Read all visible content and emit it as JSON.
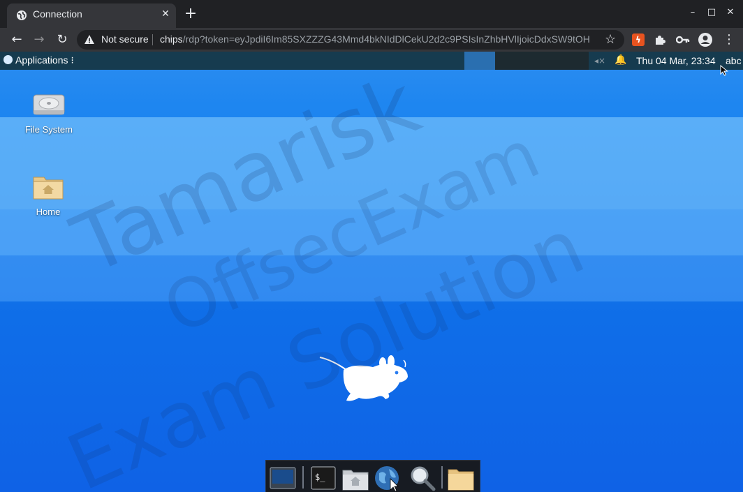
{
  "browser": {
    "tab_title": "Connection",
    "tab_close": "✕",
    "new_tab": "+",
    "window": {
      "minimize": "–",
      "maximize": "□",
      "close": "✕"
    },
    "nav": {
      "back": "←",
      "forward": "→",
      "reload": "↻"
    },
    "security_label": "Not secure",
    "url_host": "chips",
    "url_path": "/rdp?token=eyJpdiI6Im85SXZZZG43Mmd4bkNIdDlCekU2d2c9PSIsInZhbHVlIjoicDdxSW9tOH",
    "star": "☆",
    "menu": "⋮"
  },
  "desktop": {
    "panel": {
      "applications_label": "Applications ⁝",
      "clock": "Thu 04 Mar, 23:34",
      "user": "abc"
    },
    "icons": [
      {
        "label": "File System"
      },
      {
        "label": "Home"
      }
    ],
    "watermark": {
      "line1": "Tamarisk",
      "line2": "OffsecExam",
      "line3": "Exam Solution"
    },
    "dock_icons": [
      "show-desktop-icon",
      "terminal-icon",
      "home-folder-icon",
      "web-browser-icon",
      "search-icon",
      "folder-icon"
    ],
    "terminal_glyph": "$_"
  },
  "colors": {
    "chrome_bg": "#202124",
    "toolbar_bg": "#35363a",
    "desktop_top": "#2c8df0",
    "desktop_bottom": "#0f62e6",
    "panel_bg": "#163b4f"
  }
}
